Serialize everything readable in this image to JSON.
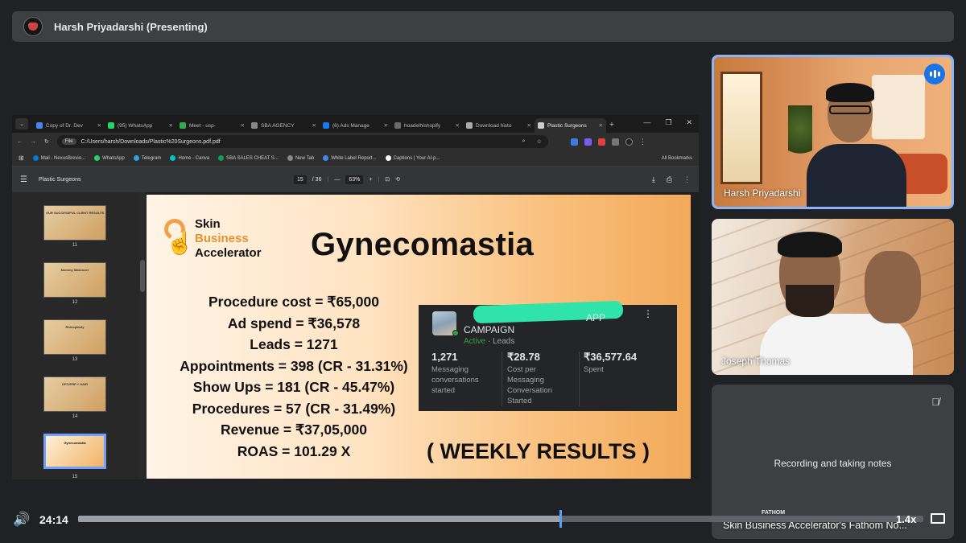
{
  "presenter_bar": {
    "title": "Harsh Priyadarshi (Presenting)"
  },
  "browser": {
    "tabs": [
      {
        "label": "Copy of Dr. Dev",
        "color": "#4285f4"
      },
      {
        "label": "(95) WhatsApp",
        "color": "#25d366"
      },
      {
        "label": "Meet - usp-",
        "color": "#34a853"
      },
      {
        "label": "SBA AGENCY",
        "color": "#888888"
      },
      {
        "label": "(6) Ads Manage",
        "color": "#1877f2"
      },
      {
        "label": "hoadelhishopify",
        "color": "#6a6a6a"
      },
      {
        "label": "Download histo",
        "color": "#aaaaaa"
      },
      {
        "label": "Plastic Surgeons",
        "color": "#cccccc",
        "active": true
      }
    ],
    "address_badge": "File",
    "url": "C:/Users/harsh/Downloads/Plastic%20Surgeons.pdf.pdf",
    "bookmarks": [
      {
        "label": "Mail - NexusBrevio...",
        "color": "#0078d4"
      },
      {
        "label": "WhatsApp",
        "color": "#25d366"
      },
      {
        "label": "Telegram",
        "color": "#2aa3df"
      },
      {
        "label": "Home - Canva",
        "color": "#00c4cc"
      },
      {
        "label": "SBA SALES CHEAT S...",
        "color": "#0f9d58"
      },
      {
        "label": "New Tab",
        "color": "#888888"
      },
      {
        "label": "White Label Report...",
        "color": "#4285f4"
      },
      {
        "label": "Captions | Your AI-p...",
        "color": "#ffffff"
      }
    ],
    "all_bookmarks": "All Bookmarks"
  },
  "pdf": {
    "doc_title": "Plastic Surgeons",
    "page_current": "15",
    "page_total": "/ 36",
    "zoom": "63%",
    "thumbnails": [
      {
        "num": "11",
        "text": "OUR SUCCESSFUL CLIENT RESULTS"
      },
      {
        "num": "12",
        "text": "Mommy Makeover"
      },
      {
        "num": "13",
        "text": "Rhinoplasty"
      },
      {
        "num": "14",
        "text": "GFC/PRP + HAIR"
      },
      {
        "num": "15",
        "text": "Gynecomastia",
        "selected": true
      }
    ]
  },
  "slide": {
    "logo": {
      "line1": "Skin",
      "line2": "Business",
      "line3": "Accelerator"
    },
    "headline": "Gynecomastia",
    "stats": [
      "Procedure cost = ₹65,000",
      "Ad spend = ₹36,578",
      "Leads = 1271",
      "Appointments = 398 (CR - 31.31%)",
      "Show Ups = 181 (CR - 45.47%)",
      "Procedures = 57 (CR - 31.49%)",
      "Revenue = ₹37,05,000",
      "ROAS = 101.29 X"
    ],
    "footer": "( WEEKLY RESULTS )",
    "campaign": {
      "name_suffix": "APP",
      "name": "CAMPAIGN",
      "status": "Active",
      "objective": "Leads",
      "metrics": [
        {
          "value": "1,271",
          "label": "Messaging conversations started"
        },
        {
          "value": "₹28.78",
          "label": "Cost per Messaging Conversation Started"
        },
        {
          "value": "₹36,577.64",
          "label": "Spent"
        }
      ]
    }
  },
  "participants": [
    {
      "name": "Harsh Priyadarshi",
      "speaking": true
    },
    {
      "name": "Joseph Thomas"
    },
    {
      "name": "Skin Business Accelerator's Fathom No...",
      "note": "Recording and taking notes",
      "brand": "FATHOM"
    }
  ],
  "player": {
    "time": "24:14",
    "speed": "1.4x",
    "progress": 0.57
  }
}
